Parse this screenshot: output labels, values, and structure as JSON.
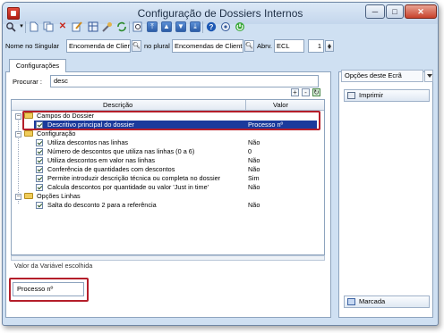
{
  "window": {
    "title": "Configuração de Dossiers Internos",
    "close_glyph": "✕",
    "min_glyph": "─",
    "max_glyph": "□"
  },
  "toolbar": {
    "icons": [
      "search-icon",
      "new-document-icon",
      "copy-icon",
      "delete-icon",
      "edit-icon",
      "grid-icon",
      "refresh-icon",
      "link-icon",
      "preview-icon",
      "first-record-icon",
      "previous-record-icon",
      "next-record-icon",
      "last-record-icon",
      "help-icon",
      "settings-icon",
      "power-icon"
    ]
  },
  "fields": {
    "singular_label": "Nome no Singular",
    "singular_value": "Encomenda de Clier",
    "plural_label": "no plural",
    "plural_value": "Encomendas de Client",
    "abrev_label": "Abrv.",
    "abrev_value": "ECL",
    "number_value": "1"
  },
  "tabs": {
    "configuracoes": "Configurações"
  },
  "search": {
    "label": "Procurar :",
    "value": "desc"
  },
  "grid": {
    "col_descricao": "Descrição",
    "col_valor": "Valor",
    "groups": [
      {
        "label": "Campos do Dossier",
        "items": [
          {
            "label": "Descritivo principal do dossier",
            "value": "Processo nº",
            "selected": true
          }
        ]
      },
      {
        "label": "Configuração",
        "items": [
          {
            "label": "Utiliza descontos nas linhas",
            "value": "Não"
          },
          {
            "label": "Número de descontos que utiliza nas linhas (0 a 6)",
            "value": "0"
          },
          {
            "label": "Utiliza descontos em valor nas linhas",
            "value": "Não"
          },
          {
            "label": "Conferência de quantidades com descontos",
            "value": "Não"
          },
          {
            "label": "Permite introduzir descrição técnica ou completa no dossier",
            "value": "Sim"
          },
          {
            "label": "Calcula descontos por quantidade ou valor 'Just in time'",
            "value": "Não"
          }
        ]
      },
      {
        "label": "Opções Linhas",
        "items": [
          {
            "label": "Salta do desconto 2 para a referência",
            "value": "Não"
          }
        ]
      }
    ]
  },
  "bottom": {
    "valor_label": "Valor da Variável escolhida",
    "valor_value": "Processo nº"
  },
  "right_panel": {
    "select_value": "Opções deste Ecrã",
    "imprimir": "Imprimir",
    "marcada": "Marcada"
  },
  "colors": {
    "selection": "#1a3a9c",
    "highlight_box": "#b41e2a",
    "window_bg": "#cfe0f2"
  }
}
